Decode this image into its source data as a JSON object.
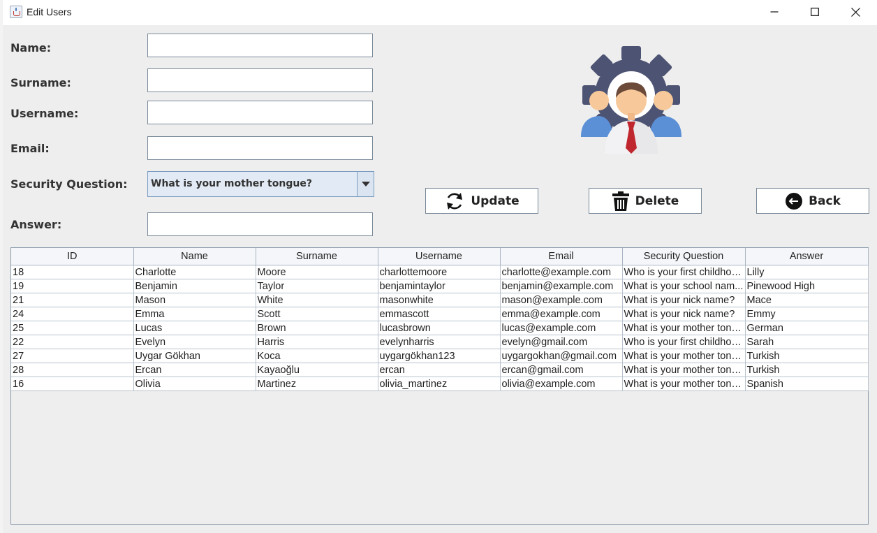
{
  "window": {
    "title": "Edit Users"
  },
  "form": {
    "name_label": "Name:",
    "surname_label": "Surname:",
    "username_label": "Username:",
    "email_label": "Email:",
    "security_question_label": "Security Question:",
    "answer_label": "Answer:",
    "name_value": "",
    "surname_value": "",
    "username_value": "",
    "email_value": "",
    "answer_value": "",
    "security_question_selected": "What is your mother tongue?"
  },
  "buttons": {
    "update_label": "Update",
    "delete_label": "Delete",
    "back_label": "Back"
  },
  "icons": {
    "app": "java-cup-icon",
    "update": "refresh-icon",
    "delete": "trash-icon",
    "back": "arrow-left-circle-icon",
    "illustration": "user-admin-gear-icon"
  },
  "colors": {
    "gear": "#4d5373",
    "tie": "#c0262d",
    "side_users": "#5b8fd6",
    "skin": "#f7c99a",
    "hair": "#6b4a3a"
  },
  "table": {
    "columns": [
      "ID",
      "Name",
      "Surname",
      "Username",
      "Email",
      "Security Question",
      "Answer"
    ],
    "rows": [
      [
        "18",
        "Charlotte",
        "Moore",
        "charlottemoore",
        "charlotte@example.com",
        "Who is your first childhoo...",
        "Lilly"
      ],
      [
        "19",
        "Benjamin",
        "Taylor",
        "benjamintaylor",
        "benjamin@example.com",
        "What is your school nam...",
        "Pinewood High"
      ],
      [
        "21",
        "Mason",
        "White",
        "masonwhite",
        "mason@example.com",
        "What is your nick name?",
        "Mace"
      ],
      [
        "24",
        "Emma",
        "Scott",
        "emmascott",
        "emma@example.com",
        "What is your nick name?",
        "Emmy"
      ],
      [
        "25",
        "Lucas",
        "Brown",
        "lucasbrown",
        "lucas@example.com",
        "What is your mother tong...",
        "German"
      ],
      [
        "22",
        "Evelyn",
        "Harris",
        "evelynharris",
        "evelyn@gmail.com",
        "Who is your first childhoo...",
        "Sarah"
      ],
      [
        "27",
        "Uygar Gökhan",
        "Koca",
        "uygargökhan123",
        "uygargokhan@gmail.com",
        "What is your mother tong...",
        "Turkish"
      ],
      [
        "28",
        "Ercan",
        "Kayaoğlu",
        "ercan",
        "ercan@gmail.com",
        "What is your mother tong...",
        "Turkish"
      ],
      [
        "16",
        "Olivia",
        "Martinez",
        "olivia_martinez",
        "olivia@example.com",
        "What is your mother tong...",
        "Spanish"
      ]
    ]
  }
}
